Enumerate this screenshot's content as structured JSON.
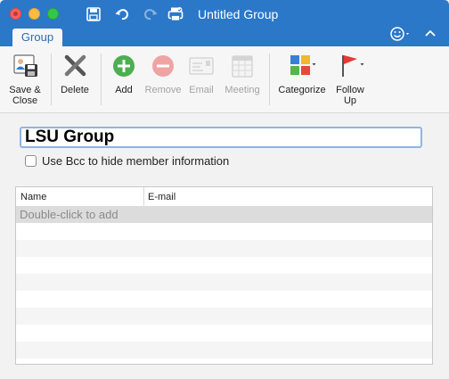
{
  "window": {
    "title": "Untitled Group",
    "controls": [
      "close",
      "minimize",
      "maximize"
    ]
  },
  "quick_access": [
    "save-icon",
    "undo-icon",
    "redo-icon",
    "print-icon"
  ],
  "tabs": [
    {
      "label": "Group",
      "active": true
    }
  ],
  "ribbon": {
    "save_close": "Save & Close",
    "delete": "Delete",
    "add": "Add",
    "remove": "Remove",
    "email": "Email",
    "meeting": "Meeting",
    "categorize": "Categorize",
    "follow_up": "Follow Up"
  },
  "group_name": {
    "value": "LSU Group"
  },
  "bcc_option": {
    "label": "Use Bcc to hide member information",
    "checked": false
  },
  "member_list": {
    "columns": [
      "Name",
      "E-mail"
    ],
    "placeholder": "Double-click to add",
    "members": []
  },
  "colors": {
    "titlebar": "#2b78c9",
    "accent_green": "#4caf50",
    "disabled_red": "#f0a3a3",
    "flag_red": "#e53935"
  }
}
